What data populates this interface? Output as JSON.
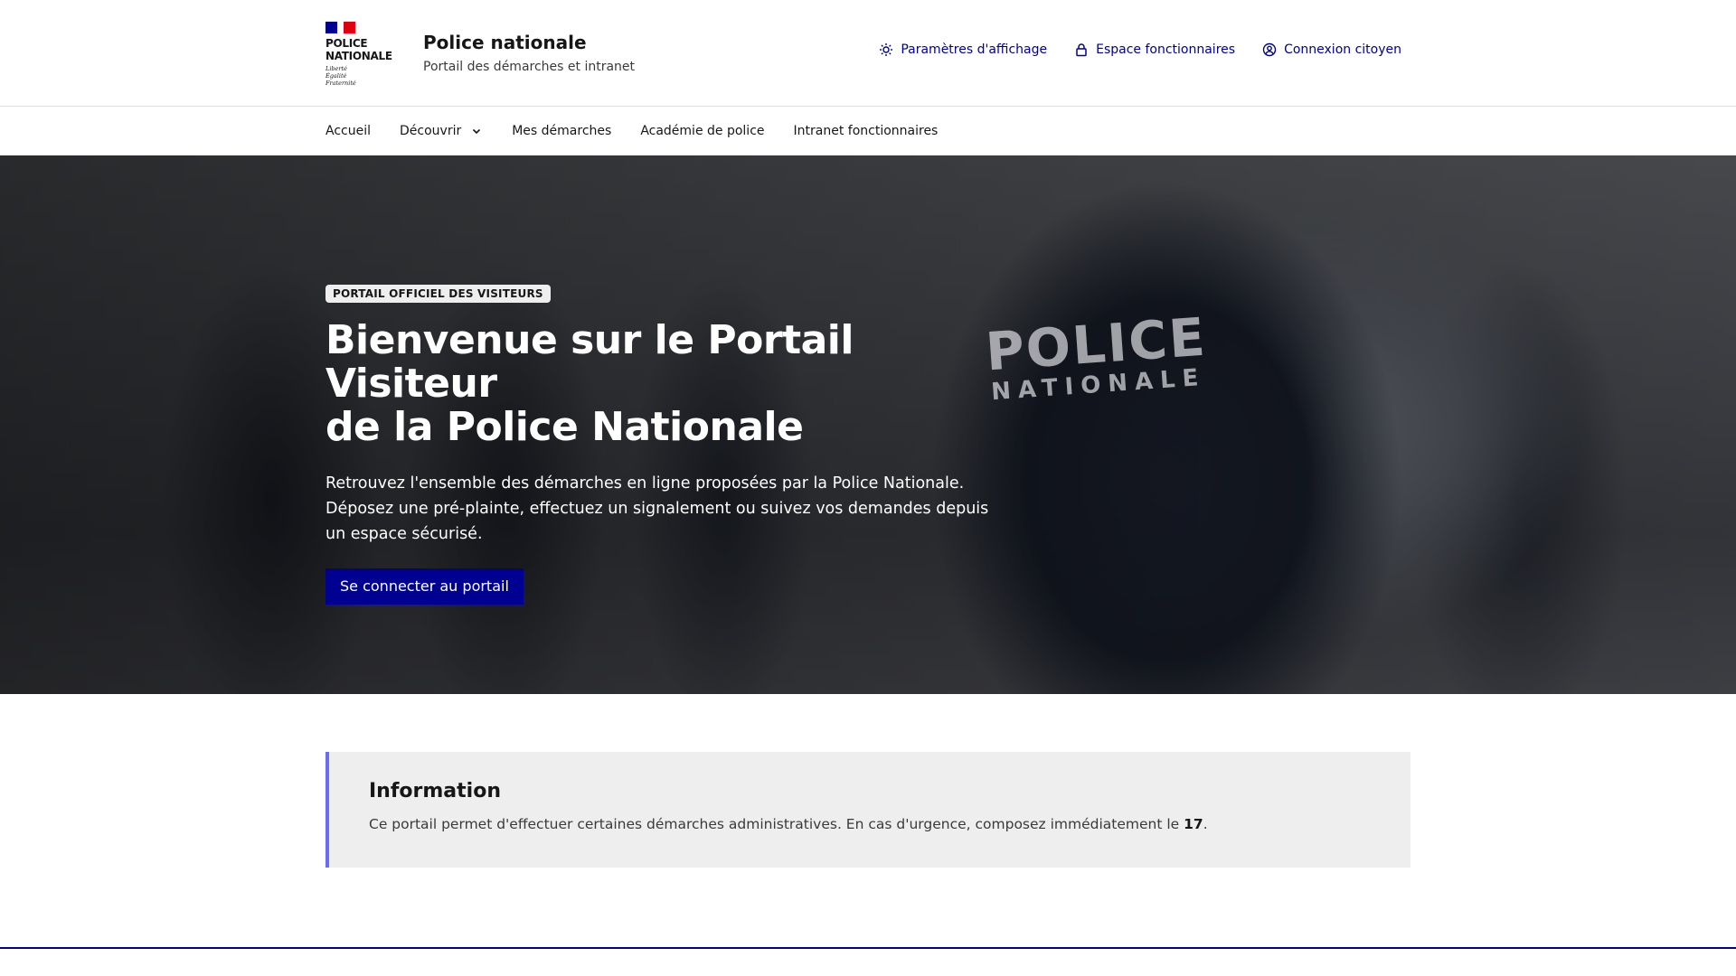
{
  "header": {
    "logo": {
      "line1": "POLICE",
      "line2": "NATIONALE",
      "motto1": "Liberté",
      "motto2": "Égalité",
      "motto3": "Fraternité"
    },
    "site_name": "Police nationale",
    "tagline": "Portail des démarches et intranet",
    "tools": {
      "display_settings": "Paramètres d'affichage",
      "staff_space": "Espace fonctionnaires",
      "citizen_login": "Connexion citoyen"
    }
  },
  "nav": {
    "items": [
      "Accueil",
      "Découvrir",
      "Mes démarches",
      "Académie de police",
      "Intranet fonctionnaires"
    ]
  },
  "hero": {
    "badge": "PORTAIL OFFICIEL DES VISITEURS",
    "title_line1": "Bienvenue sur le Portail Visiteur",
    "title_line2": "de la Police Nationale",
    "description": "Retrouvez l'ensemble des démarches en ligne proposées par la Police Nationale. Déposez une pré-plainte, effectuez un signalement ou suivez vos demandes depuis un espace sécurisé.",
    "cta": "Se connecter au portail",
    "image_text_line1": "POLICE",
    "image_text_line2": "NATIONALE"
  },
  "info": {
    "title": "Information",
    "text_before": "Ce portail permet d'effectuer certaines démarches administratives. En cas d'urgence, composez immédiatement le ",
    "emergency_number": "17",
    "text_after": "."
  },
  "colors": {
    "primary": "#000091",
    "callout_border": "#6a6af4",
    "callout_bg": "#eeeeee"
  }
}
